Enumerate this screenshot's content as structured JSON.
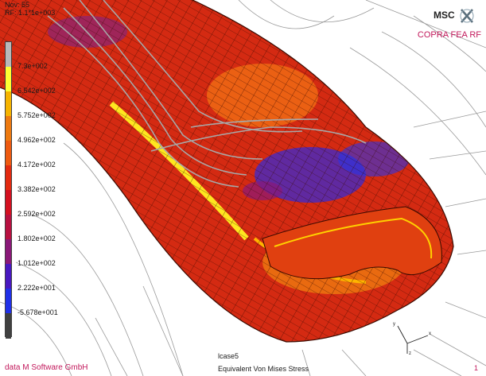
{
  "header": {
    "line1": "Nov: 55",
    "line2": "RF: 1.1*1e+003"
  },
  "legend": {
    "colors": [
      "#b9b9b9",
      "#ffff33",
      "#f6b400",
      "#ee7a10",
      "#ee5a10",
      "#e32a10",
      "#d41020",
      "#b81040",
      "#8a1878",
      "#4818c0",
      "#2030e8",
      "#404040"
    ],
    "ticks": [
      "7.3e+002",
      "6.542e+002",
      "5.752e+002",
      "4.962e+002",
      "4.172e+002",
      "3.382e+002",
      "2.592e+002",
      "1.802e+002",
      "1.012e+002",
      "2.222e+001",
      "-5.678e+001"
    ]
  },
  "branding": {
    "logo": "MSC",
    "product": "COPRA FEA RF"
  },
  "footer": {
    "company": "data M Software GmbH",
    "loadcase": "lcase5",
    "result": "Equivalent Von Mises Stress",
    "page": "1"
  },
  "triad": {
    "x": "x",
    "y": "y",
    "z": "z"
  }
}
